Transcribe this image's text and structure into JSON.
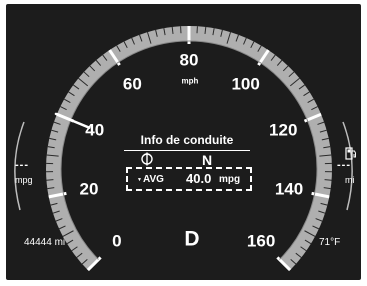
{
  "speedometer": {
    "scale_labels": [
      "0",
      "20",
      "40",
      "60",
      "80",
      "100",
      "120",
      "140",
      "160"
    ],
    "unit_label": "mph",
    "needle_value_mph": 40,
    "max_value_mph": 160,
    "fill_value_mph": 40,
    "arc_color": "#c9c9c9",
    "needle_color": "#ffffff"
  },
  "info_panel": {
    "title": "Info de conduite",
    "heading": "N",
    "compass_icon": "compass-icon",
    "avg_indicator": "▼",
    "avg_label": "AVG",
    "avg_value": "40.0",
    "avg_unit": "mpg"
  },
  "left_gauge": {
    "dashes": "---",
    "unit": "mpg"
  },
  "right_gauge": {
    "icon": "fuel-pump-icon",
    "dashes": "---",
    "unit": "mi"
  },
  "bottom": {
    "odometer_value": "44444",
    "odometer_unit": "mi",
    "gear": "D",
    "outside_temp": "71°F"
  }
}
